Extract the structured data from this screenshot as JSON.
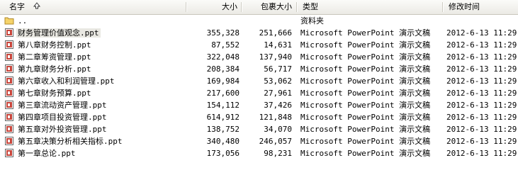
{
  "columns": {
    "name": "名字",
    "size": "大小",
    "packed": "包裹大小",
    "type": "类型",
    "modified": "修改时间"
  },
  "parent_row": {
    "name": "..",
    "type": "资料夹"
  },
  "files": [
    {
      "name": "财务管理价值观念.ppt",
      "size": "355,328",
      "packed": "251,666",
      "type": "Microsoft PowerPoint 演示文稿",
      "modified": "2012-6-13 11:29"
    },
    {
      "name": "第八章财务控制.ppt",
      "size": "87,552",
      "packed": "14,631",
      "type": "Microsoft PowerPoint 演示文稿",
      "modified": "2012-6-13 11:29"
    },
    {
      "name": "第二章筹资管理.ppt",
      "size": "322,048",
      "packed": "137,940",
      "type": "Microsoft PowerPoint 演示文稿",
      "modified": "2012-6-13 11:29"
    },
    {
      "name": "第九章财务分析.ppt",
      "size": "208,384",
      "packed": "56,717",
      "type": "Microsoft PowerPoint 演示文稿",
      "modified": "2012-6-13 11:29"
    },
    {
      "name": "第六章收入和利润管理.ppt",
      "size": "169,984",
      "packed": "53,062",
      "type": "Microsoft PowerPoint 演示文稿",
      "modified": "2012-6-13 11:29"
    },
    {
      "name": "第七章财务预算.ppt",
      "size": "217,600",
      "packed": "27,961",
      "type": "Microsoft PowerPoint 演示文稿",
      "modified": "2012-6-13 11:29"
    },
    {
      "name": "第三章流动资产管理.ppt",
      "size": "154,112",
      "packed": "37,426",
      "type": "Microsoft PowerPoint 演示文稿",
      "modified": "2012-6-13 11:29"
    },
    {
      "name": "第四章项目投资管理.ppt",
      "size": "614,912",
      "packed": "121,848",
      "type": "Microsoft PowerPoint 演示文稿",
      "modified": "2012-6-13 11:29"
    },
    {
      "name": "第五章对外投资管理.ppt",
      "size": "138,752",
      "packed": "34,070",
      "type": "Microsoft PowerPoint 演示文稿",
      "modified": "2012-6-13 11:29"
    },
    {
      "name": "第五章决策分析相关指标.ppt",
      "size": "340,480",
      "packed": "246,057",
      "type": "Microsoft PowerPoint 演示文稿",
      "modified": "2012-6-13 11:29"
    },
    {
      "name": "第一章总论.ppt",
      "size": "173,056",
      "packed": "98,231",
      "type": "Microsoft PowerPoint 演示文稿",
      "modified": "2012-6-13 11:29"
    }
  ],
  "colors": {
    "selected_row": "#e9e8e2",
    "folder": "#f5d36a",
    "ppt_icon": "#c8453b"
  },
  "icons": {
    "sort": "sort-up-arrow-icon",
    "folder": "folder-icon",
    "file": "ppt-file-icon"
  }
}
